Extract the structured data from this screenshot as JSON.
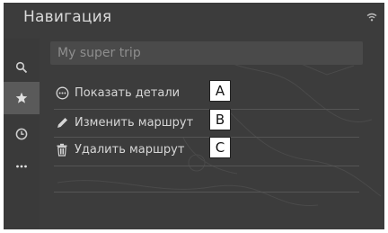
{
  "header": {
    "title": "Навигация"
  },
  "rail": {
    "icons": [
      "search-icon",
      "star-icon",
      "clock-icon",
      "more-icon"
    ]
  },
  "trip": {
    "name": "My super trip"
  },
  "menu": [
    {
      "label": "Показать детали",
      "icon": "more-circle-icon",
      "callout": "A"
    },
    {
      "label": "Изменить маршрут",
      "icon": "pencil-icon",
      "callout": "B"
    },
    {
      "label": "Удалить маршрут",
      "icon": "trash-icon",
      "callout": "C"
    }
  ],
  "colors": {
    "background": "#3c3c3c",
    "text": "#d6d6d6",
    "active_rail": "#5a5a5a"
  }
}
